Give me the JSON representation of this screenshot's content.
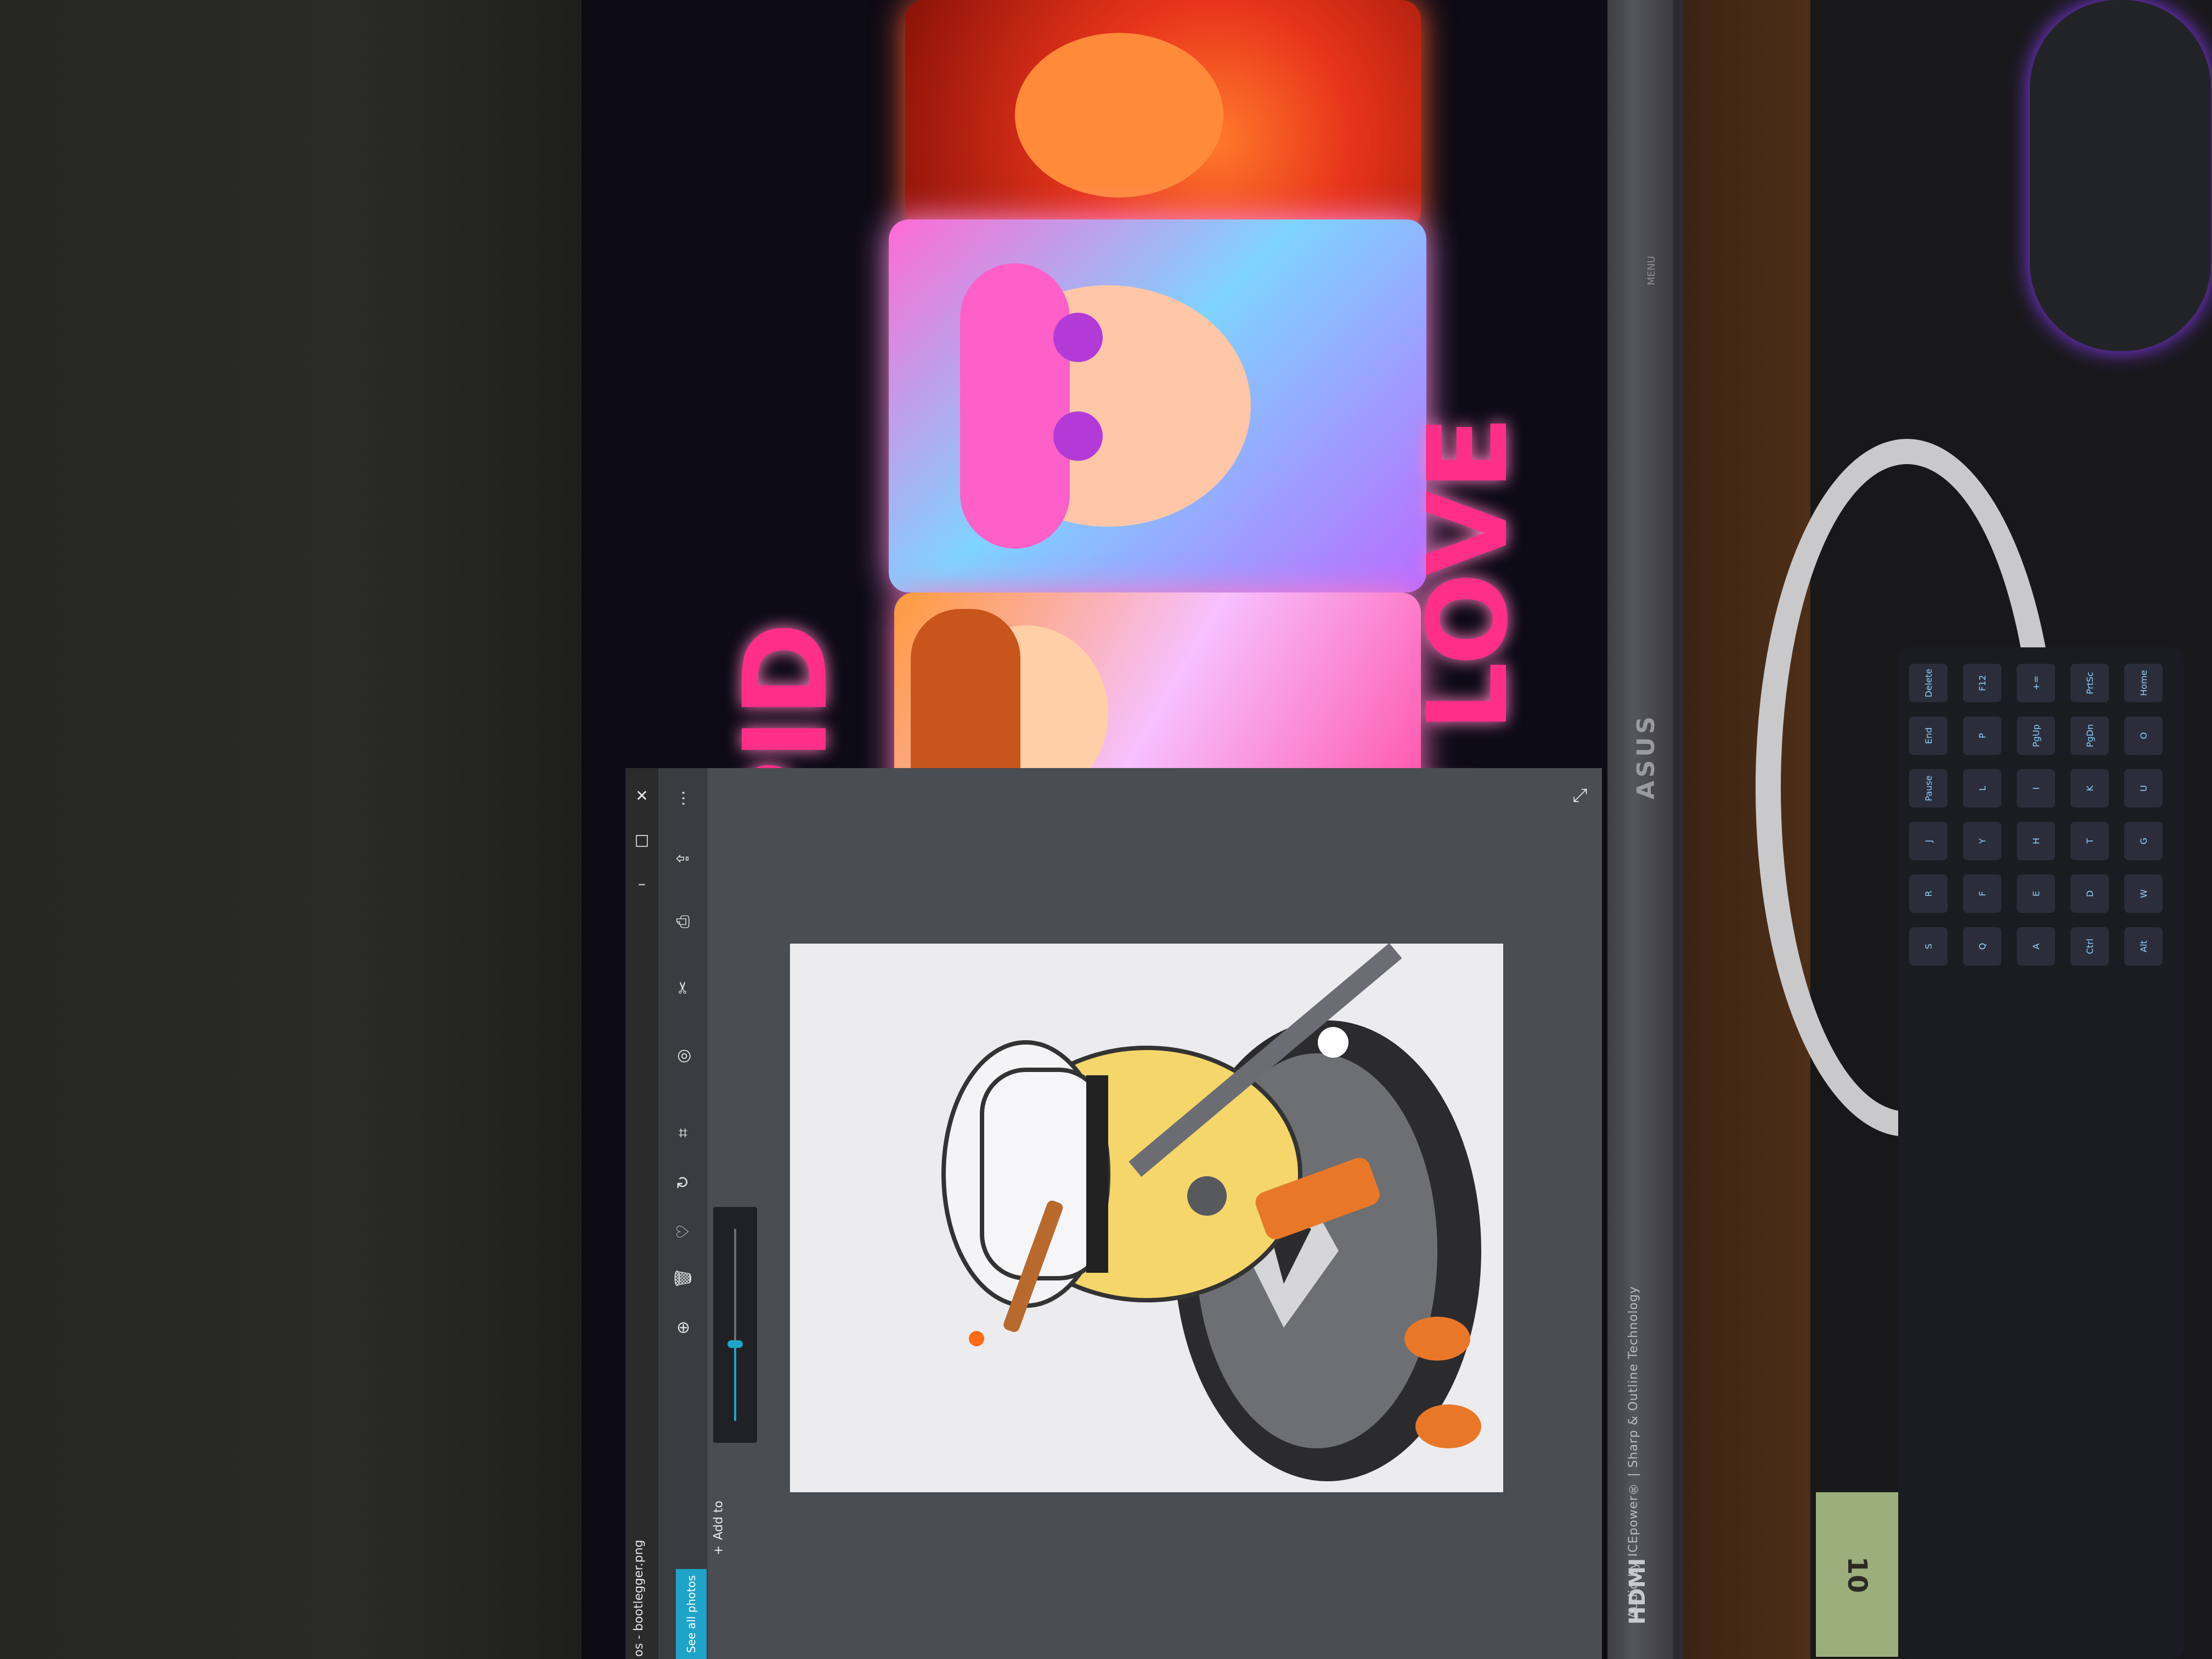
{
  "scene": {
    "monitor_brand": "ASUS",
    "monitor_footer": "Audio by ICEpower® | Sharp & Outline Technology",
    "hdmi_label": "HDMI",
    "menu_labels": "MENU"
  },
  "background_page": {
    "title_fragment_1": "PID",
    "title_fragment_2": "F LOVE"
  },
  "photos_app": {
    "window_title": "os - bootlegger.png",
    "window_controls": {
      "minimize": "–",
      "maximize": "□",
      "close": "✕"
    },
    "toolbar": {
      "see_all_label": "See all photos",
      "add_to_label": "Add to",
      "icons": [
        "more-options-icon",
        "share-icon",
        "draw-icon",
        "edit-icon",
        "enhance-icon",
        "crop-icon",
        "rotate-icon",
        "favorite-icon",
        "delete-icon",
        "zoom-icon"
      ]
    },
    "zoom": {
      "level": 0.4
    },
    "expand_icon": "expand-icon",
    "image": {
      "description_name": "bootlegger"
    }
  },
  "colors": {
    "accent": "#1fa3c8",
    "pink_title": "#ff2e88",
    "window_bg": "#4a4d52"
  },
  "desk": {
    "cash_label": "10",
    "keyboard_keys": [
      "Delete",
      "F12",
      "+=",
      "PrtSc",
      "Home",
      "End",
      "P",
      "PgUp",
      "PgDn",
      "O",
      "Pause",
      "L",
      "I",
      "K",
      "U",
      "J",
      "Y",
      "H",
      "T",
      "G",
      "R",
      "F",
      "E",
      "D",
      "W",
      "S",
      "Q",
      "A",
      "Ctrl",
      "Alt"
    ]
  }
}
